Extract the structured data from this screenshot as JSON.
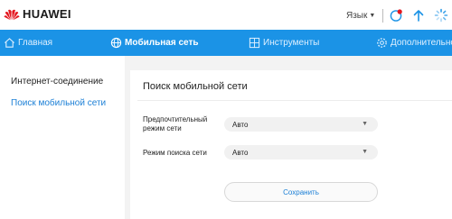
{
  "brand": {
    "name": "HUAWEI",
    "logo_color": "#e3171f"
  },
  "topbar": {
    "language_label": "Язык"
  },
  "nav": {
    "items": [
      {
        "label": "Главная",
        "icon": "home-icon"
      },
      {
        "label": "Мобильная сеть",
        "icon": "globe-icon",
        "active": true
      },
      {
        "label": "Инструменты",
        "icon": "tools-icon"
      },
      {
        "label": "Дополнительно",
        "icon": "gear-icon"
      }
    ],
    "color": "#1b93e6"
  },
  "sidebar": {
    "items": [
      {
        "label": "Интернет-соединение"
      },
      {
        "label": "Поиск мобильной сети",
        "active": true
      }
    ]
  },
  "main": {
    "title": "Поиск мобильной сети",
    "fields": [
      {
        "label": "Предпочтительный режим сети",
        "value": "Авто"
      },
      {
        "label": "Режим поиска сети",
        "value": "Авто"
      }
    ],
    "save_label": "Сохранить"
  }
}
